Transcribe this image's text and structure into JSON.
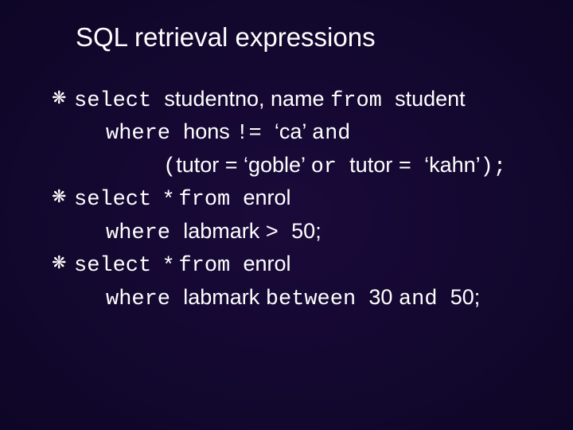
{
  "title": "SQL retrieval expressions",
  "bullet_glyph": "❋",
  "items": [
    {
      "l1_a": "select ",
      "l1_b": "studentno, name ",
      "l1_c": "from ",
      "l1_d": "student",
      "l2_a": "where ",
      "l2_b": "hons ",
      "l2_c": "!= ",
      "l2_d": "‘ca’ ",
      "l2_e": "and",
      "l3_a": "(",
      "l3_b": "tutor = ‘goble’ ",
      "l3_c": "or ",
      "l3_d": "tutor ",
      "l3_e": "= ",
      "l3_f": "‘kahn’",
      "l3_g": ");"
    },
    {
      "l1_a": "select ",
      "l1_b": "* ",
      "l1_c": "from ",
      "l1_d": "enrol",
      "l2_a": "where ",
      "l2_b": "labmark ",
      "l2_c": "> ",
      "l2_d": "50;"
    },
    {
      "l1_a": "select ",
      "l1_b": "* ",
      "l1_c": "from ",
      "l1_d": "enrol",
      "l2_a": "where ",
      "l2_b": "labmark ",
      "l2_c": "between ",
      "l2_d": "30 ",
      "l2_e": "and ",
      "l2_f": "50;"
    }
  ]
}
